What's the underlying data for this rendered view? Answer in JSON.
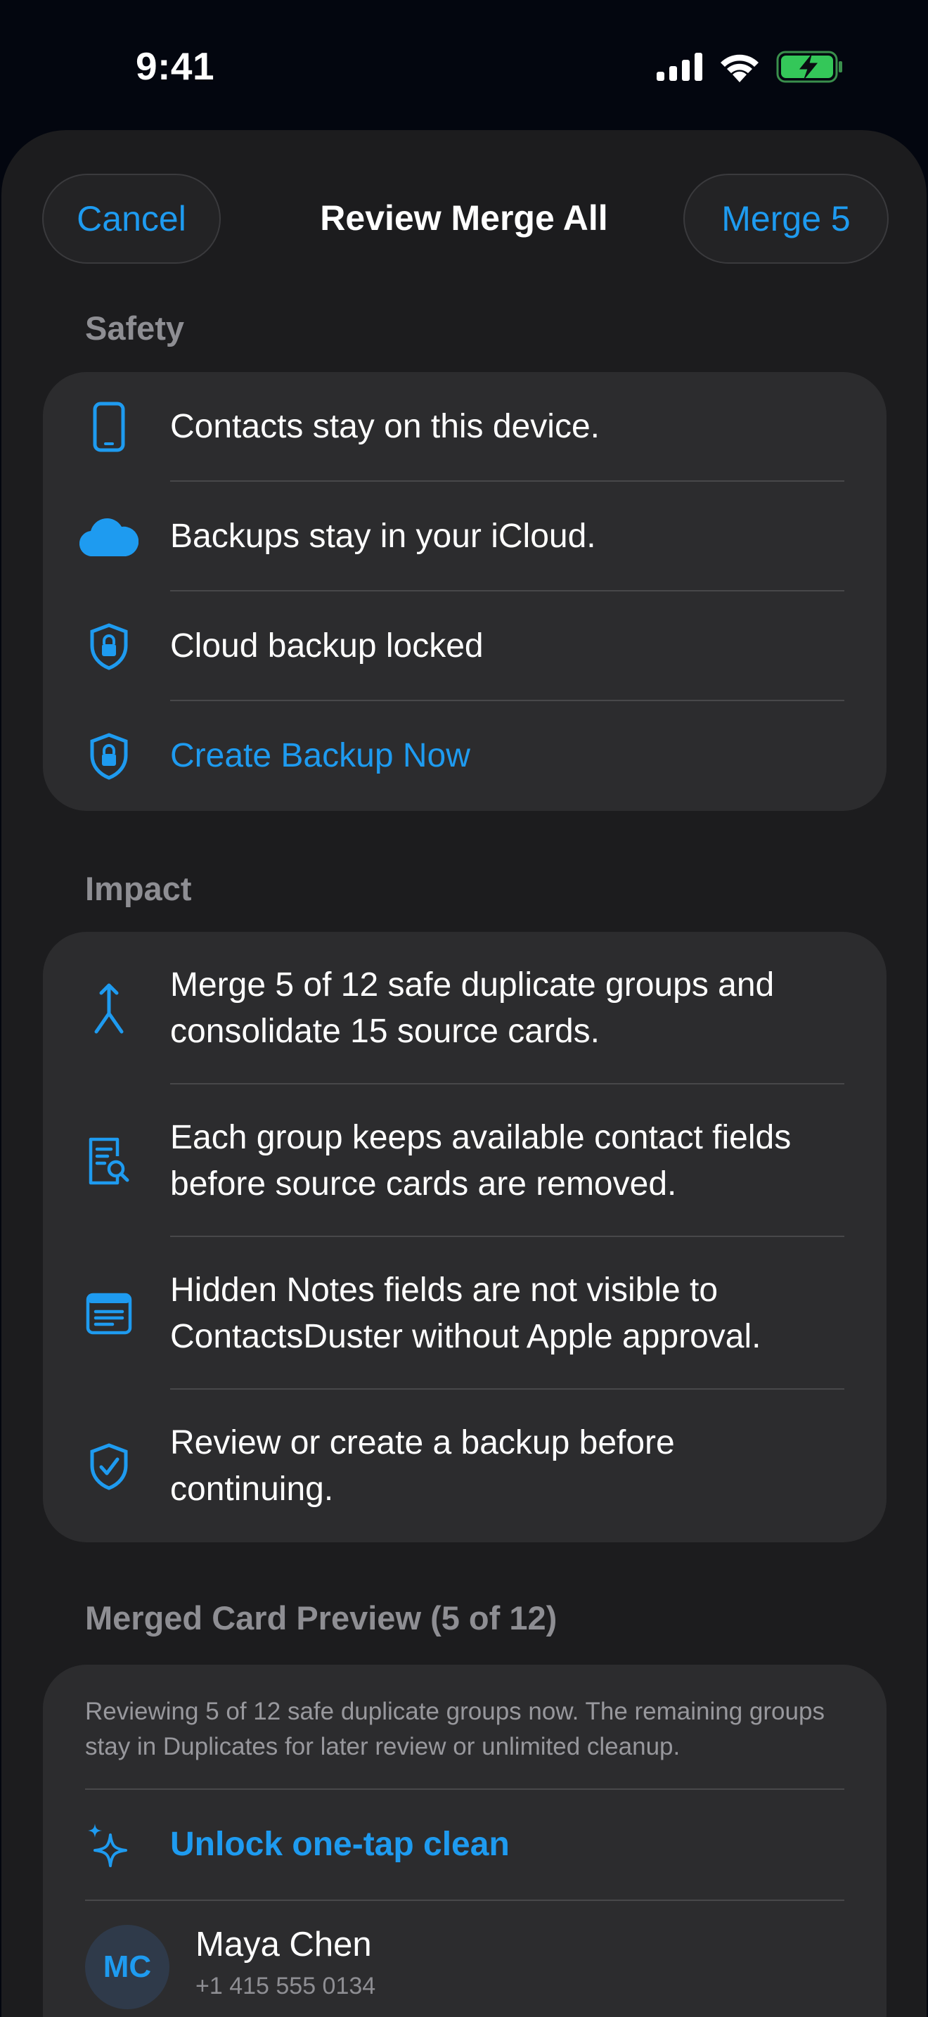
{
  "status_bar": {
    "time": "9:41",
    "icons": [
      "cellular-signal-icon",
      "wifi-icon",
      "battery-charging-icon"
    ],
    "battery_color": "#34c759"
  },
  "nav": {
    "cancel_label": "Cancel",
    "title": "Review Merge All",
    "merge_label": "Merge 5"
  },
  "safety": {
    "header": "Safety",
    "items": [
      {
        "icon": "phone-icon",
        "label": "Contacts stay on this device."
      },
      {
        "icon": "cloud-icon",
        "label": "Backups stay in your iCloud."
      },
      {
        "icon": "lock-shield-icon",
        "label": "Cloud backup locked"
      },
      {
        "icon": "lock-shield-icon",
        "label": "Create Backup Now"
      }
    ]
  },
  "impact": {
    "header": "Impact",
    "items": [
      {
        "icon": "merge-arrow-icon",
        "label": "Merge 5 of 12 safe duplicate groups and consolidate 15 source cards."
      },
      {
        "icon": "document-search-icon",
        "label": "Each group keeps available contact fields before source cards are removed."
      },
      {
        "icon": "notes-icon",
        "label": "Hidden Notes fields are not visible to ContactsDuster without Apple approval."
      },
      {
        "icon": "checkmark-shield-icon",
        "label": "Review or create a backup before continuing."
      }
    ]
  },
  "preview": {
    "header": "Merged Card Preview (5 of 12)",
    "note": "Reviewing 5 of 12 safe duplicate groups now. The remaining groups stay in Duplicates for later review or unlimited cleanup.",
    "unlock_label": "Unlock one-tap clean",
    "contact": {
      "initials": "MC",
      "name": "Maya Chen",
      "phone": "+1 415 555 0134"
    }
  },
  "colors": {
    "accent": "#1e9bf0",
    "background": "#1c1c1e",
    "card": "#2c2c2e",
    "secondary_text": "#8e8e93"
  }
}
